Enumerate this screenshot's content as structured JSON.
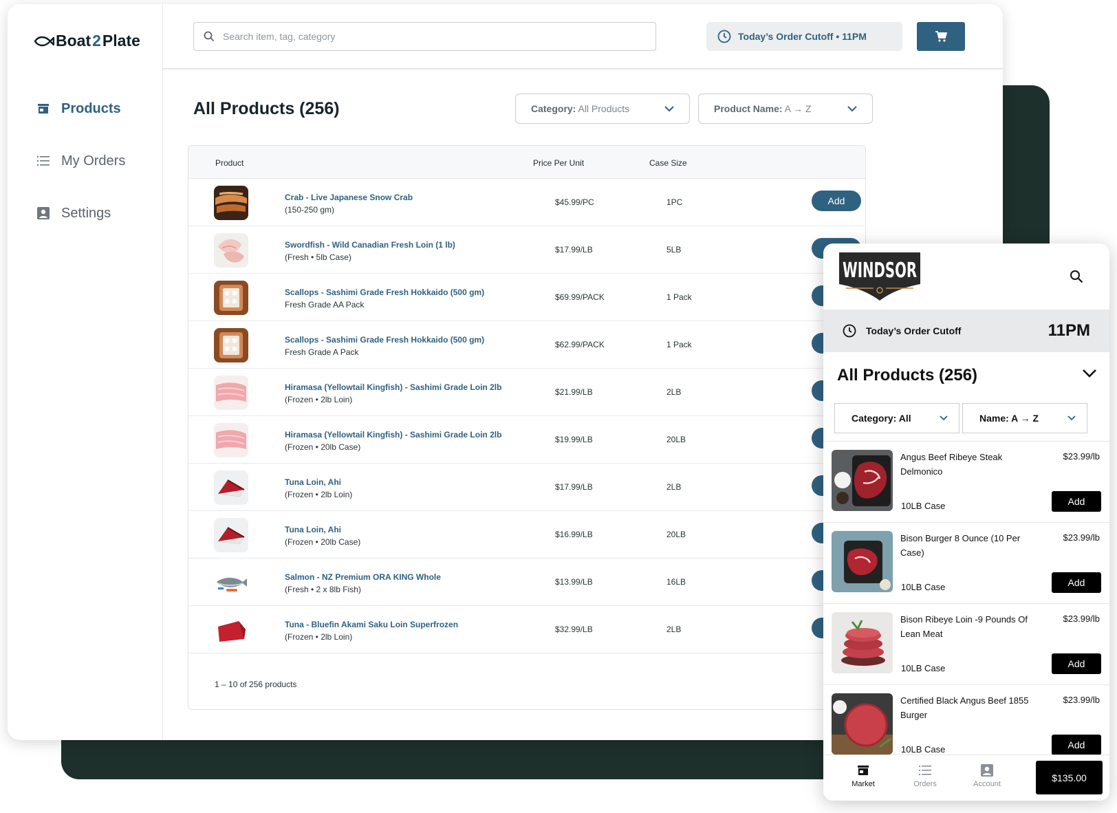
{
  "brand": {
    "logo_text_a": "Boat",
    "logo_text_b": "2",
    "logo_text_c": "Plate"
  },
  "sidebar": {
    "items": [
      {
        "label": "Products",
        "icon": "store-icon",
        "active": true
      },
      {
        "label": "My Orders",
        "icon": "list-icon",
        "active": false
      },
      {
        "label": "Settings",
        "icon": "person-badge-icon",
        "active": false
      }
    ]
  },
  "header": {
    "search_placeholder": "Search item, tag, category",
    "cutoff": "Today’s Order Cutoff • 11PM"
  },
  "main": {
    "title": "All Products (256)",
    "filter_category_label": "Category:",
    "filter_category_value": "All Products",
    "filter_name_label": "Product Name:",
    "filter_name_value": "A → Z"
  },
  "table": {
    "columns": [
      "Product",
      "Price Per Unit",
      "Case Size"
    ],
    "add_label": "Add",
    "rows": [
      {
        "name": "Crab - Live Japanese Snow Crab",
        "sub": "(150-250 gm)",
        "price": "$45.99/PC",
        "case": "1PC",
        "thumb": "crab"
      },
      {
        "name": "Swordfish - Wild Canadian Fresh Loin (1 lb)",
        "sub": "(Fresh • 5lb Case)",
        "price": "$17.99/LB",
        "case": "5LB",
        "thumb": "swordfish"
      },
      {
        "name": "Scallops - Sashimi Grade Fresh Hokkaido (500 gm)",
        "sub": "Fresh Grade AA Pack",
        "price": "$69.99/PACK",
        "case": "1 Pack",
        "thumb": "scallop"
      },
      {
        "name": "Scallops - Sashimi Grade Fresh Hokkaido (500 gm)",
        "sub": "Fresh Grade A Pack",
        "price": "$62.99/PACK",
        "case": "1 Pack",
        "thumb": "scallop"
      },
      {
        "name": "Hiramasa (Yellowtail Kingfish) - Sashimi Grade Loin 2lb",
        "sub": "(Frozen • 2lb Loin)",
        "price": "$21.99/LB",
        "case": "2LB",
        "thumb": "hiramasa"
      },
      {
        "name": "Hiramasa (Yellowtail Kingfish) - Sashimi Grade Loin 2lb",
        "sub": "(Frozen • 20lb Case)",
        "price": "$19.99/LB",
        "case": "20LB",
        "thumb": "hiramasa"
      },
      {
        "name": "Tuna Loin, Ahi",
        "sub": "(Frozen • 2lb Loin)",
        "price": "$17.99/LB",
        "case": "2LB",
        "thumb": "tuna"
      },
      {
        "name": "Tuna Loin, Ahi",
        "sub": "(Frozen • 20lb Case)",
        "price": "$16.99/LB",
        "case": "20LB",
        "thumb": "tuna"
      },
      {
        "name": "Salmon - NZ Premium ORA KING Whole",
        "sub": "(Fresh • 2 x 8lb Fish)",
        "price": "$13.99/LB",
        "case": "16LB",
        "thumb": "salmon"
      },
      {
        "name": "Tuna - Bluefin Akami Saku Loin Superfrozen",
        "sub": "(Frozen • 2lb Loin)",
        "price": "$32.99/LB",
        "case": "2LB",
        "thumb": "bluefin"
      }
    ],
    "pager": "1 – 10 of 256 products"
  },
  "mobile": {
    "brand": "WINDSOR",
    "cutoff_label": "Today’s Order Cutoff",
    "cutoff_time": "11PM",
    "title": "All Products (256)",
    "category": "Category: All",
    "name_sort": "Name: A → Z",
    "add_label": "Add",
    "items": [
      {
        "name": "Angus Beef Ribeye Steak Delmonico",
        "price": "$23.99/lb",
        "case": "10LB Case",
        "img": "ribeye"
      },
      {
        "name": "Bison Burger 8 Ounce (10  Per Case)",
        "price": "$23.99/lb",
        "case": "10LB Case",
        "img": "bison-steak"
      },
      {
        "name": "Bison Ribeye Loin -9 Pounds Of Lean Meat",
        "price": "$23.99/lb",
        "case": "10LB Case",
        "img": "patties"
      },
      {
        "name": "Certified Black Angus Beef 1855 Burger",
        "price": "$23.99/lb",
        "case": "10LB Case",
        "img": "burger"
      }
    ],
    "tabs": [
      {
        "label": "Market",
        "icon": "store-icon",
        "active": true
      },
      {
        "label": "Orders",
        "icon": "list-icon",
        "active": false
      },
      {
        "label": "Account",
        "icon": "person-badge-icon",
        "active": false
      }
    ],
    "total": "$135.00"
  },
  "colors": {
    "accent": "#2f6181",
    "dark": "#1e302c"
  }
}
